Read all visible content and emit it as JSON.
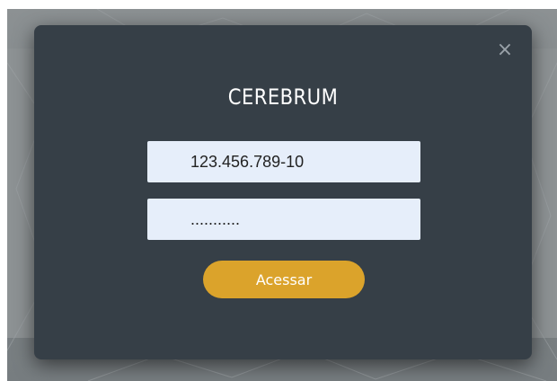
{
  "dialog": {
    "close_glyph": "×",
    "title": "CEREBRUM",
    "cpf_value": "123.456.789-10",
    "password_value": "...........",
    "submit_label": "Acessar"
  },
  "colors": {
    "modal_background": "#363f47",
    "input_background": "#e6eefa",
    "button_background": "#dba32b",
    "title_text": "#ffffff"
  },
  "icons": [
    "close-icon"
  ]
}
